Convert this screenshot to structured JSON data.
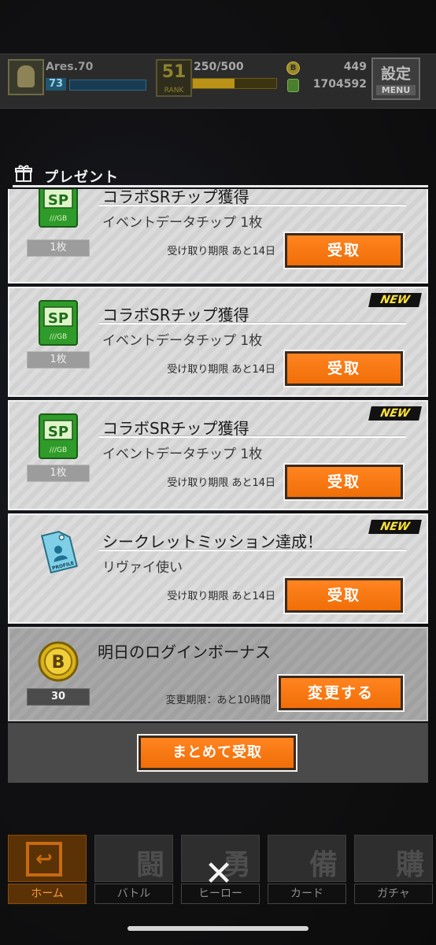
{
  "hud": {
    "player_name": "Ares.70",
    "player_level": "73",
    "rank": "51",
    "rank_label": "RANK",
    "stamina": "250/500",
    "coins": "449",
    "money": "1704592",
    "settings_label": "設定",
    "menu_label": "MENU"
  },
  "panel": {
    "title": "プレゼント"
  },
  "items": [
    {
      "title": "コラボSRチップ獲得",
      "subtitle": "イベントデータチップ 1枚",
      "count": "1枚",
      "deadline": "受け取り期限 あと14日",
      "button": "受取",
      "new": ""
    },
    {
      "title": "コラボSRチップ獲得",
      "subtitle": "イベントデータチップ 1枚",
      "count": "1枚",
      "deadline": "受け取り期限 あと14日",
      "button": "受取",
      "new": "NEW"
    },
    {
      "title": "コラボSRチップ獲得",
      "subtitle": "イベントデータチップ 1枚",
      "count": "1枚",
      "deadline": "受け取り期限 あと14日",
      "button": "受取",
      "new": "NEW"
    },
    {
      "title": "シークレットミッション達成！",
      "subtitle": "リヴァイ使い",
      "count": "",
      "deadline": "受け取り期限 あと14日",
      "button": "受取",
      "new": "NEW"
    },
    {
      "title": "明日のログインボーナス",
      "subtitle": "",
      "count": "30",
      "deadline": "変更期限：あと10時間",
      "button": "変更する",
      "new": ""
    }
  ],
  "bulk_button": "まとめて受取",
  "nav": [
    {
      "label": "ホーム",
      "kanji": "",
      "active": true
    },
    {
      "label": "バトル",
      "kanji": "闘",
      "active": false
    },
    {
      "label": "ヒーロー",
      "kanji": "勇",
      "active": false
    },
    {
      "label": "カード",
      "kanji": "備",
      "active": false
    },
    {
      "label": "ガチャ",
      "kanji": "購",
      "active": false
    }
  ],
  "icons": {
    "chip": "sp-chip-icon",
    "profile": "profile-tag-icon",
    "coin": "b-coin-icon",
    "gift": "gift-icon",
    "close": "close-icon"
  },
  "colors": {
    "accent": "#f06e08",
    "new_text": "#ffe23a"
  }
}
